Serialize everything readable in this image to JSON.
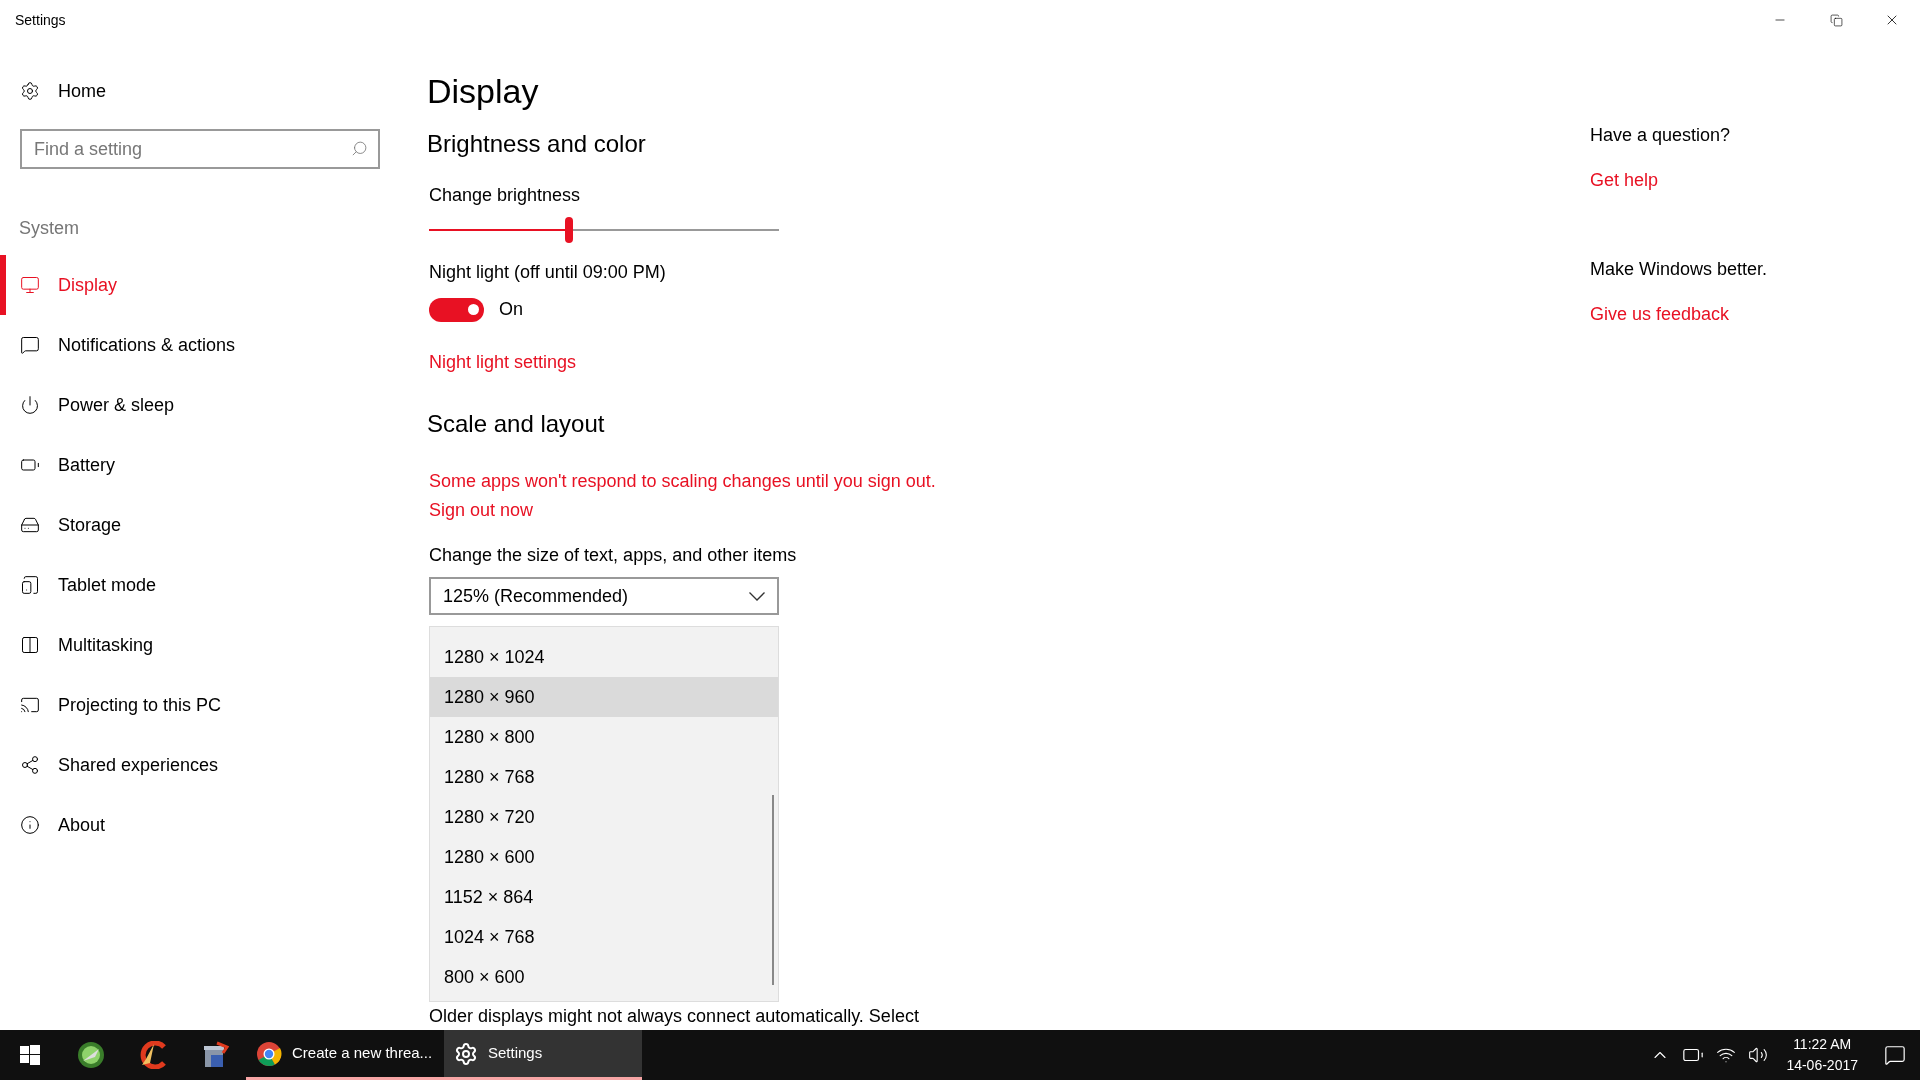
{
  "window": {
    "title": "Settings"
  },
  "sidebar": {
    "home": "Home",
    "search": {
      "placeholder": "Find a setting"
    },
    "section": "System",
    "items": [
      {
        "label": "Display",
        "selected": true
      },
      {
        "label": "Notifications & actions",
        "selected": false
      },
      {
        "label": "Power & sleep",
        "selected": false
      },
      {
        "label": "Battery",
        "selected": false
      },
      {
        "label": "Storage",
        "selected": false
      },
      {
        "label": "Tablet mode",
        "selected": false
      },
      {
        "label": "Multitasking",
        "selected": false
      },
      {
        "label": "Projecting to this PC",
        "selected": false
      },
      {
        "label": "Shared experiences",
        "selected": false
      },
      {
        "label": "About",
        "selected": false
      }
    ]
  },
  "main": {
    "title": "Display",
    "brightness_section": "Brightness and color",
    "brightness": {
      "label": "Change brightness",
      "level": 0.4
    },
    "night_light": {
      "label": "Night light (off until 09:00 PM)",
      "on": true,
      "state_text": "On",
      "link": "Night light settings"
    },
    "scale_section": "Scale and layout",
    "warning": "Some apps won't respond to scaling changes until you sign out.",
    "sign_out": "Sign out now",
    "size": {
      "label": "Change the size of text, apps, and other items",
      "value": "125% (Recommended)"
    },
    "resolution_options": [
      {
        "label": "1280 × 1024",
        "selected": false
      },
      {
        "label": "1280 × 960",
        "selected": true
      },
      {
        "label": "1280 × 800",
        "selected": false
      },
      {
        "label": "1280 × 768",
        "selected": false
      },
      {
        "label": "1280 × 720",
        "selected": false
      },
      {
        "label": "1280 × 600",
        "selected": false
      },
      {
        "label": "1152 × 864",
        "selected": false
      },
      {
        "label": "1024 × 768",
        "selected": false
      },
      {
        "label": "800 × 600",
        "selected": false
      }
    ],
    "note": "Older displays might not always connect automatically. Select"
  },
  "help": {
    "question": "Have a question?",
    "get_help": "Get help",
    "better": "Make Windows better.",
    "feedback": "Give us feedback"
  },
  "taskbar": {
    "windows": [
      {
        "label": "Create a new threa...",
        "selected": false
      },
      {
        "label": "Settings",
        "selected": true
      }
    ],
    "time": "11:22 AM",
    "date": "14-06-2017"
  }
}
